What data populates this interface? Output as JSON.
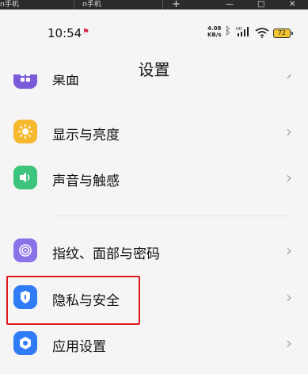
{
  "browser": {
    "tab1": "п手机",
    "tab2": "п手机",
    "new_tab": "+",
    "minimize": "—",
    "maximize": "□",
    "close": "✕"
  },
  "status": {
    "time": "10:54",
    "rate_top": "4.08",
    "rate_bottom": "KB/s",
    "hd": "HD",
    "battery": "72"
  },
  "header": {
    "title": "设置"
  },
  "settings": {
    "items": [
      {
        "label": "桌面",
        "icon": "desktop-icon",
        "color": "#7a5ad8"
      },
      {
        "label": "显示与亮度",
        "icon": "sun-icon",
        "color": "#f5b82e"
      },
      {
        "label": "声音与触感",
        "icon": "speaker-icon",
        "color": "#3cc47c"
      },
      {
        "label": "指纹、面部与密码",
        "icon": "fingerprint-icon",
        "color": "#8a72e8"
      },
      {
        "label": "隐私与安全",
        "icon": "shield-icon",
        "color": "#2f7cf6"
      },
      {
        "label": "应用设置",
        "icon": "app-settings-icon",
        "color": "#2f7cf6"
      }
    ]
  },
  "colors": {
    "highlight": "#e0191f",
    "background": "#f5f5f5"
  }
}
